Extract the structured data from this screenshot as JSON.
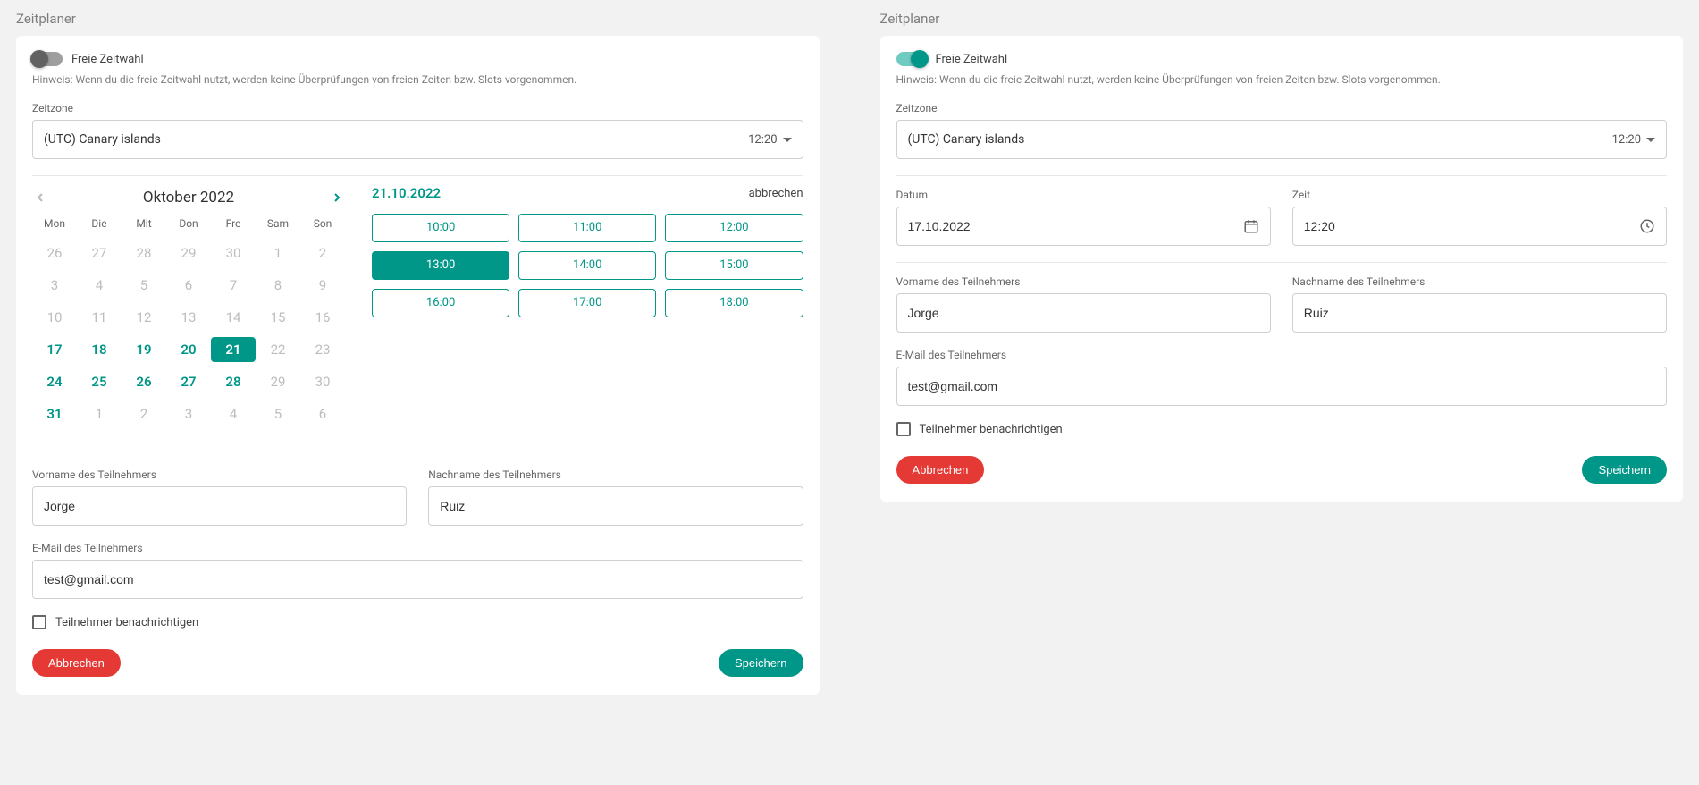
{
  "left": {
    "title": "Zeitplaner",
    "freeToggleLabel": "Freie Zeitwahl",
    "freeToggleOn": false,
    "hint": "Hinweis: Wenn du die freie Zeitwahl nutzt, werden keine Überprüfungen von freien Zeiten bzw. Slots vorgenommen.",
    "timezoneLabel": "Zeitzone",
    "timezoneValue": "(UTC) Canary islands",
    "timezoneTime": "12:20",
    "calendar": {
      "monthTitle": "Oktober 2022",
      "dow": [
        "Mon",
        "Die",
        "Mit",
        "Don",
        "Fre",
        "Sam",
        "Son"
      ],
      "weeks": [
        [
          {
            "n": "26",
            "t": "muted"
          },
          {
            "n": "27",
            "t": "muted"
          },
          {
            "n": "28",
            "t": "muted"
          },
          {
            "n": "29",
            "t": "muted"
          },
          {
            "n": "30",
            "t": "muted"
          },
          {
            "n": "1",
            "t": "muted"
          },
          {
            "n": "2",
            "t": "muted"
          }
        ],
        [
          {
            "n": "3",
            "t": "muted"
          },
          {
            "n": "4",
            "t": "muted"
          },
          {
            "n": "5",
            "t": "muted"
          },
          {
            "n": "6",
            "t": "muted"
          },
          {
            "n": "7",
            "t": "muted"
          },
          {
            "n": "8",
            "t": "muted"
          },
          {
            "n": "9",
            "t": "muted"
          }
        ],
        [
          {
            "n": "10",
            "t": "muted"
          },
          {
            "n": "11",
            "t": "muted"
          },
          {
            "n": "12",
            "t": "muted"
          },
          {
            "n": "13",
            "t": "muted"
          },
          {
            "n": "14",
            "t": "muted"
          },
          {
            "n": "15",
            "t": "muted"
          },
          {
            "n": "16",
            "t": "muted"
          }
        ],
        [
          {
            "n": "17",
            "t": "avail"
          },
          {
            "n": "18",
            "t": "avail"
          },
          {
            "n": "19",
            "t": "avail"
          },
          {
            "n": "20",
            "t": "avail"
          },
          {
            "n": "21",
            "t": "selected"
          },
          {
            "n": "22",
            "t": "muted"
          },
          {
            "n": "23",
            "t": "muted"
          }
        ],
        [
          {
            "n": "24",
            "t": "avail"
          },
          {
            "n": "25",
            "t": "avail"
          },
          {
            "n": "26",
            "t": "avail"
          },
          {
            "n": "27",
            "t": "avail"
          },
          {
            "n": "28",
            "t": "avail"
          },
          {
            "n": "29",
            "t": "muted"
          },
          {
            "n": "30",
            "t": "muted"
          }
        ],
        [
          {
            "n": "31",
            "t": "avail"
          },
          {
            "n": "1",
            "t": "muted"
          },
          {
            "n": "2",
            "t": "muted"
          },
          {
            "n": "3",
            "t": "muted"
          },
          {
            "n": "4",
            "t": "muted"
          },
          {
            "n": "5",
            "t": "muted"
          },
          {
            "n": "6",
            "t": "muted"
          }
        ]
      ]
    },
    "slotsHeaderDate": "21.10.2022",
    "slotsCancel": "abbrechen",
    "slots": [
      {
        "label": "10:00",
        "sel": false
      },
      {
        "label": "11:00",
        "sel": false
      },
      {
        "label": "12:00",
        "sel": false
      },
      {
        "label": "13:00",
        "sel": true
      },
      {
        "label": "14:00",
        "sel": false
      },
      {
        "label": "15:00",
        "sel": false
      },
      {
        "label": "16:00",
        "sel": false
      },
      {
        "label": "17:00",
        "sel": false
      },
      {
        "label": "18:00",
        "sel": false
      }
    ],
    "firstNameLabel": "Vorname des Teilnehmers",
    "firstName": "Jorge",
    "lastNameLabel": "Nachname des Teilnehmers",
    "lastName": "Ruiz",
    "emailLabel": "E-Mail des Teilnehmers",
    "email": "test@gmail.com",
    "notifyLabel": "Teilnehmer benachrichtigen",
    "cancelBtn": "Abbrechen",
    "saveBtn": "Speichern"
  },
  "right": {
    "title": "Zeitplaner",
    "freeToggleLabel": "Freie Zeitwahl",
    "freeToggleOn": true,
    "hint": "Hinweis: Wenn du die freie Zeitwahl nutzt, werden keine Überprüfungen von freien Zeiten bzw. Slots vorgenommen.",
    "timezoneLabel": "Zeitzone",
    "timezoneValue": "(UTC) Canary islands",
    "timezoneTime": "12:20",
    "dateLabel": "Datum",
    "dateValue": "17.10.2022",
    "timeLabel": "Zeit",
    "timeValue": "12:20",
    "firstNameLabel": "Vorname des Teilnehmers",
    "firstName": "Jorge",
    "lastNameLabel": "Nachname des Teilnehmers",
    "lastName": "Ruiz",
    "emailLabel": "E-Mail des Teilnehmers",
    "email": "test@gmail.com",
    "notifyLabel": "Teilnehmer benachrichtigen",
    "cancelBtn": "Abbrechen",
    "saveBtn": "Speichern"
  }
}
